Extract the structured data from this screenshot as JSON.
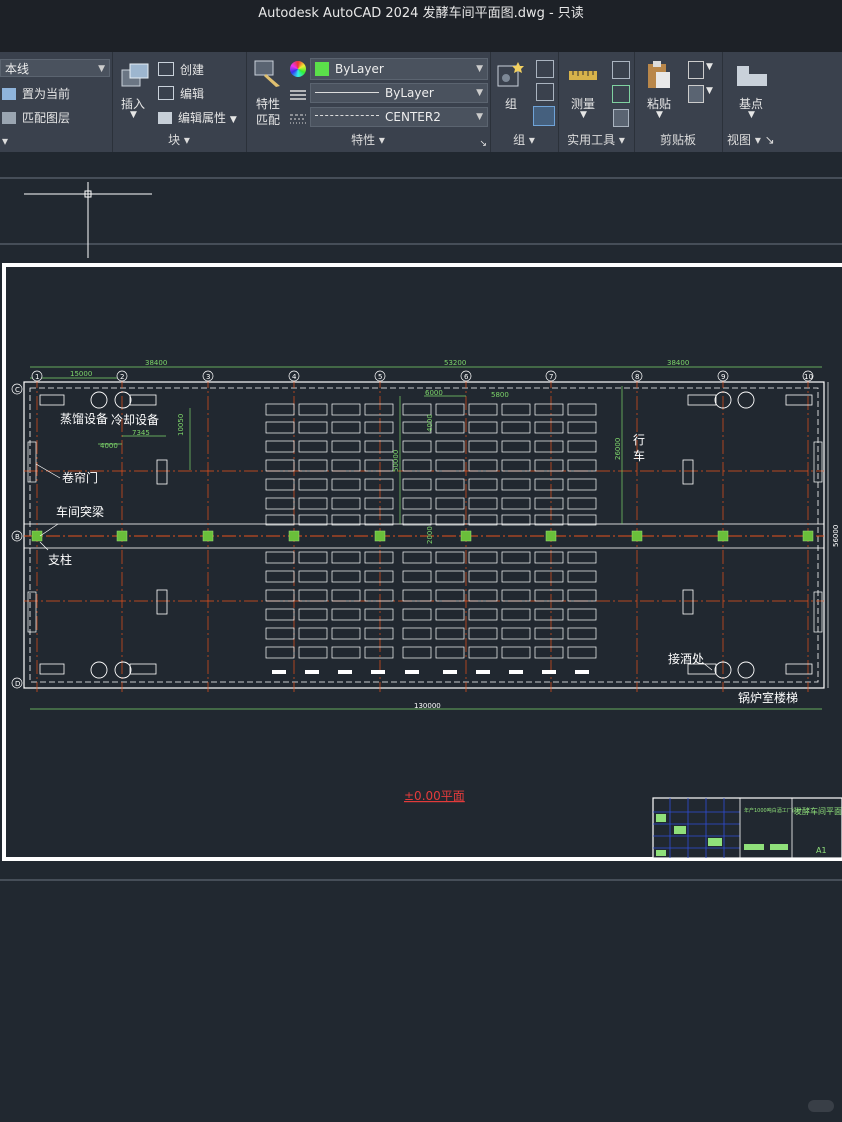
{
  "window": {
    "title": "Autodesk AutoCAD 2024    发酵车间平面图.dwg - 只读"
  },
  "ribbon": {
    "layer_panel": {
      "layer_value": "本线",
      "set_current": "置为当前",
      "match_layer": "匹配图层"
    },
    "block_panel": {
      "insert": "插入",
      "create": "创建",
      "edit": "编辑",
      "edit_attributes": "编辑属性",
      "label": "块"
    },
    "properties_panel": {
      "match_label_1": "特性",
      "match_label_2": "匹配",
      "color_value": "ByLayer",
      "lineweight_value": "ByLayer",
      "linetype_value": "CENTER2",
      "label": "特性",
      "color_accent": "#5be04a"
    },
    "groups_panel": {
      "group": "组",
      "label": "组"
    },
    "utilities_panel": {
      "measure": "测量",
      "label": "实用工具"
    },
    "clipboard_panel": {
      "paste": "粘贴",
      "label": "剪贴板"
    },
    "view_panel": {
      "base_point": "基点",
      "label": "视图"
    }
  },
  "drawing": {
    "annotations": {
      "distill": "蒸馏设备",
      "cooling": "冷却设备",
      "rolling_door": "卷帘门",
      "beam": "车间突梁",
      "column": "支柱",
      "crane_1": "行",
      "crane_2": "车",
      "wine_outlet": "接酒处",
      "boiler_stair": "锅炉室楼梯",
      "plan_title": "±0.00平面"
    },
    "dimensions": {
      "top_left": "38400",
      "top_mid": "53200",
      "top_right": "38400",
      "sub_15000": "15000",
      "d_4000": "4000",
      "d_7345": "7345",
      "d_10050": "10050",
      "d_6000": "6000",
      "d_5800": "5800",
      "d_4000b": "4000",
      "d_26000": "26000",
      "d_2000": "2000",
      "d_50000": "50000",
      "right_56000": "56000",
      "bottom_130000": "130000"
    },
    "axes": [
      "1",
      "2",
      "3",
      "4",
      "5",
      "6",
      "7",
      "8",
      "9",
      "10"
    ],
    "row_axes": [
      "C",
      "B",
      "D"
    ],
    "title_block": {
      "project": "年产1000吨白酒工厂设计",
      "drawing_name": "发酵车间平面图",
      "sheet": "A1"
    },
    "colors": {
      "wall": "#ffffff",
      "axis": "#e8521c",
      "dimension": "#7dd66a",
      "column": "#6abf3a",
      "background": "#212830"
    }
  }
}
